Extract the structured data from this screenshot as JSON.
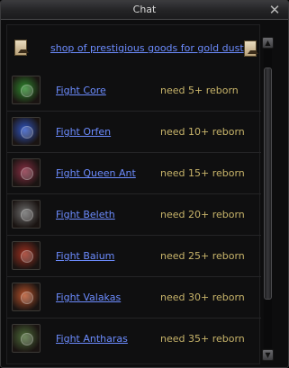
{
  "window": {
    "title": "Chat"
  },
  "header": {
    "shop_link": "shop of prestigious goods for gold dust"
  },
  "bosses": [
    {
      "name": "Fight Core",
      "requirement": "need 5+ reborn",
      "icon": "core-icon",
      "color": "#2f8a2e"
    },
    {
      "name": "Fight Orfen",
      "requirement": "need 10+ reborn",
      "icon": "orfen-icon",
      "color": "#2f56c4"
    },
    {
      "name": "Fight Queen Ant",
      "requirement": "need 15+ reborn",
      "icon": "queen-ant-icon",
      "color": "#8a2f44"
    },
    {
      "name": "Fight Beleth",
      "requirement": "need 20+ reborn",
      "icon": "beleth-icon",
      "color": "#6d6d6d"
    },
    {
      "name": "Fight Baium",
      "requirement": "need 25+ reborn",
      "icon": "baium-icon",
      "color": "#a0301f"
    },
    {
      "name": "Fight Valakas",
      "requirement": "need 30+ reborn",
      "icon": "valakas-icon",
      "color": "#b8522a"
    },
    {
      "name": "Fight Antharas",
      "requirement": "need 35+ reborn",
      "icon": "antharas-icon",
      "color": "#4f6e3a"
    }
  ],
  "scrollbar": {
    "position": 0.27
  }
}
